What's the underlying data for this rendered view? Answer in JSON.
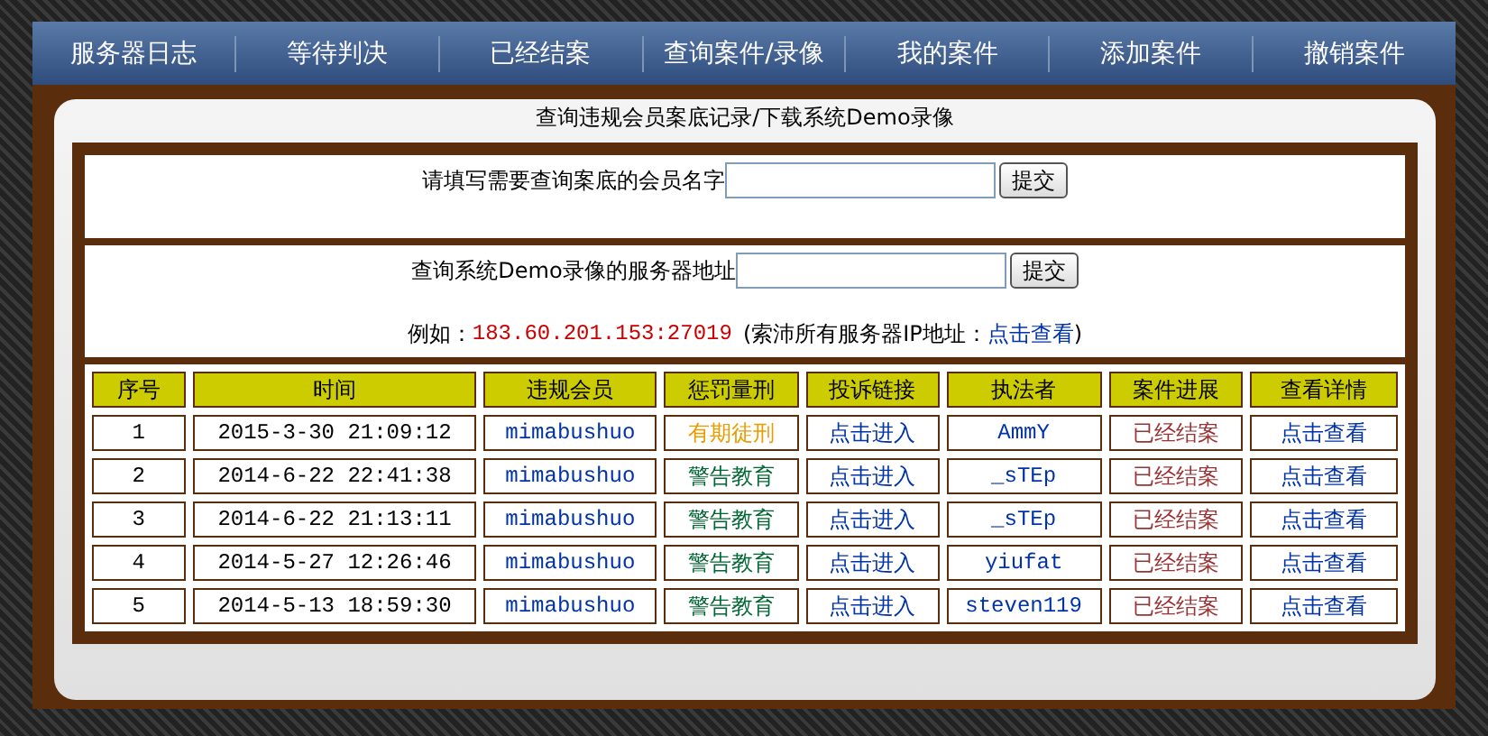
{
  "nav": [
    {
      "label": "服务器日志"
    },
    {
      "label": "等待判决"
    },
    {
      "label": "已经结案"
    },
    {
      "label": "查询案件/录像"
    },
    {
      "label": "我的案件"
    },
    {
      "label": "添加案件"
    },
    {
      "label": "撤销案件"
    }
  ],
  "panel_title": "查询违规会员案底记录/下载系统Demo录像",
  "member_query": {
    "label": "请填写需要查询案底的会员名字",
    "button": "提交"
  },
  "server_query": {
    "label": "查询系统Demo录像的服务器地址",
    "button": "提交",
    "example_label": "例如：",
    "example_value": "183.60.201.153:27019",
    "note_open": "(索沛所有服务器IP地址：",
    "note_link": "点击查看",
    "note_close": ")"
  },
  "table": {
    "columns": [
      "序号",
      "时间",
      "违规会员",
      "惩罚量刑",
      "投诉链接",
      "执法者",
      "案件进展",
      "查看详情"
    ],
    "rows": [
      {
        "no": "1",
        "time": "2015-3-30 21:09:12",
        "member": "mimabushuo",
        "penalty": {
          "text": "有期徒刑",
          "color": "#e89c00"
        },
        "complaint": "点击进入",
        "enforcer": "AmmY",
        "status": "已经结案",
        "details": "点击查看"
      },
      {
        "no": "2",
        "time": "2014-6-22 22:41:38",
        "member": "mimabushuo",
        "penalty": {
          "text": "警告教育",
          "color": "#006633"
        },
        "complaint": "点击进入",
        "enforcer": "_sTEp",
        "status": "已经结案",
        "details": "点击查看"
      },
      {
        "no": "3",
        "time": "2014-6-22 21:13:11",
        "member": "mimabushuo",
        "penalty": {
          "text": "警告教育",
          "color": "#006633"
        },
        "complaint": "点击进入",
        "enforcer": "_sTEp",
        "status": "已经结案",
        "details": "点击查看"
      },
      {
        "no": "4",
        "time": "2014-5-27 12:26:46",
        "member": "mimabushuo",
        "penalty": {
          "text": "警告教育",
          "color": "#006633"
        },
        "complaint": "点击进入",
        "enforcer": "yiufat",
        "status": "已经结案",
        "details": "点击查看"
      },
      {
        "no": "5",
        "time": "2014-5-13 18:59:30",
        "member": "mimabushuo",
        "penalty": {
          "text": "警告教育",
          "color": "#006633"
        },
        "complaint": "点击进入",
        "enforcer": "steven119",
        "status": "已经结案",
        "details": "点击查看"
      }
    ]
  }
}
